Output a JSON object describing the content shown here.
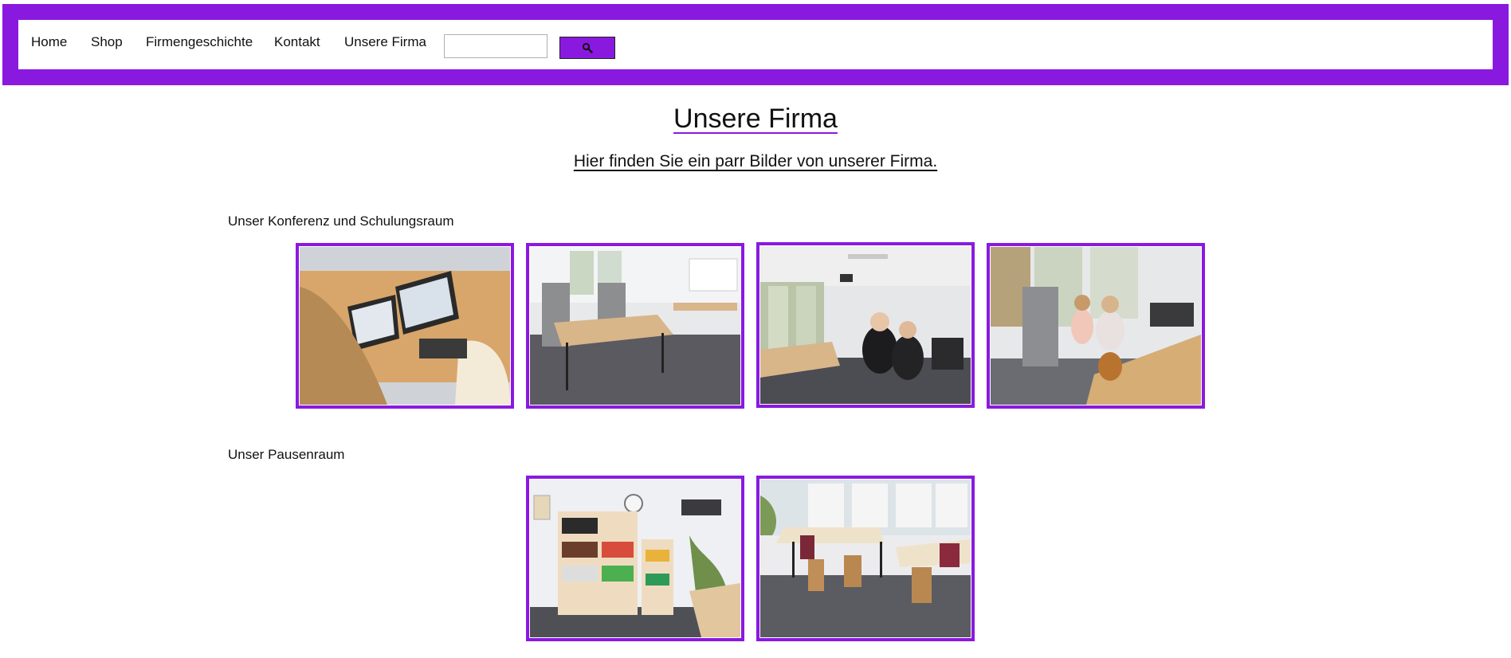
{
  "nav": {
    "items": [
      {
        "label": "Home"
      },
      {
        "label": "Shop"
      },
      {
        "label": "Firmengeschichte"
      },
      {
        "label": "Kontakt"
      },
      {
        "label": "Unsere Firma"
      }
    ],
    "search_value": "",
    "search_icon": "search-icon"
  },
  "colors": {
    "accent": "#8a19e0",
    "background": "#ffffff",
    "text": "#111111"
  },
  "main": {
    "title": "Unsere Firma",
    "subtitle": "Hier finden Sie ein parr Bilder von unserer Firma.",
    "sections": [
      {
        "label": "Unser Konferenz und Schulungsraum",
        "photo_count": 4
      },
      {
        "label": "Unser Pausenraum",
        "photo_count": 2
      }
    ]
  }
}
